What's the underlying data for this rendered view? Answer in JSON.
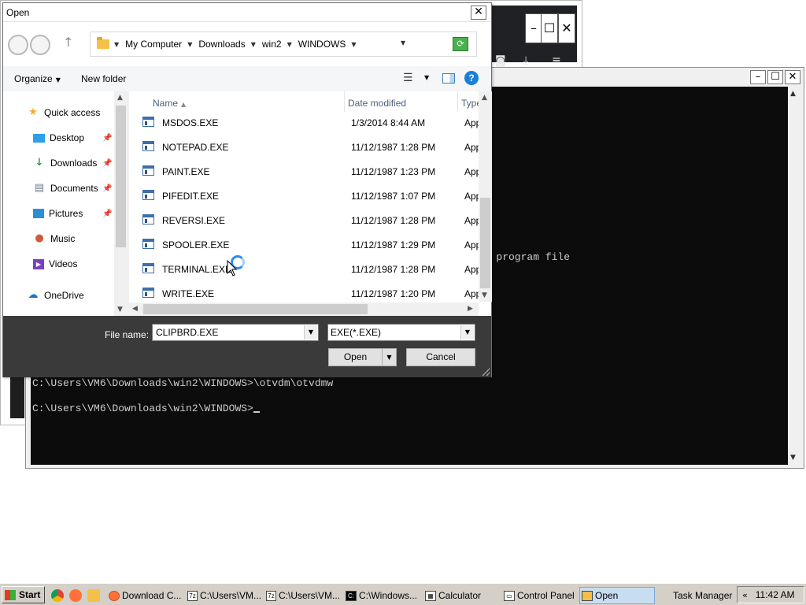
{
  "dialog": {
    "title": "Open",
    "close_label": "✕",
    "breadcrumbs": [
      "My Computer",
      "Downloads",
      "win2",
      "WINDOWS"
    ],
    "toolbar": {
      "organize": "Organize",
      "new_folder": "New folder"
    },
    "nav": {
      "quick_access": "Quick access",
      "items": [
        "Desktop",
        "Downloads",
        "Documents",
        "Pictures",
        "Music",
        "Videos"
      ],
      "onedrive": "OneDrive"
    },
    "columns": {
      "name": "Name",
      "date": "Date modified",
      "type": "Type"
    },
    "files": [
      {
        "name": "MSDOS.EXE",
        "date": "1/3/2014 8:44 AM",
        "type": "Application"
      },
      {
        "name": "NOTEPAD.EXE",
        "date": "11/12/1987 1:28 PM",
        "type": "Application"
      },
      {
        "name": "PAINT.EXE",
        "date": "11/12/1987 1:23 PM",
        "type": "Application"
      },
      {
        "name": "PIFEDIT.EXE",
        "date": "11/12/1987 1:07 PM",
        "type": "Application"
      },
      {
        "name": "REVERSI.EXE",
        "date": "11/12/1987 1:28 PM",
        "type": "Application"
      },
      {
        "name": "SPOOLER.EXE",
        "date": "11/12/1987 1:29 PM",
        "type": "Application"
      },
      {
        "name": "TERMINAL.EXE",
        "date": "11/12/1987 1:28 PM",
        "type": "Application"
      },
      {
        "name": "WRITE.EXE",
        "date": "11/12/1987 1:20 PM",
        "type": "Application"
      }
    ],
    "file_name_label": "File name:",
    "file_name_value": "CLIPBRD.EXE",
    "file_type_value": "EXE(*.EXE)",
    "open_button": "Open",
    "cancel_button": "Cancel"
  },
  "console": {
    "fragment": "id program file",
    "line1": "C:\\Users\\VM6\\Downloads\\win2\\WINDOWS>\\otvdm\\otvdmw",
    "line2": "C:\\Users\\VM6\\Downloads\\win2\\WINDOWS>"
  },
  "taskbar": {
    "start": "Start",
    "items": [
      {
        "label": "Download C...",
        "icon": "firefox-icon"
      },
      {
        "label": "C:\\Users\\VM...",
        "icon": "7zip-icon"
      },
      {
        "label": "C:\\Users\\VM...",
        "icon": "7zip-icon"
      },
      {
        "label": "C:\\Windows...",
        "icon": "cmd-icon"
      },
      {
        "label": "Calculator",
        "icon": "calculator-icon"
      },
      {
        "label": "Control Panel",
        "icon": "control-panel-icon"
      },
      {
        "label": "Open",
        "icon": "open-dialog-icon"
      },
      {
        "label": "Task Manager",
        "icon": "task-manager-icon"
      }
    ],
    "clock": "11:42 AM"
  },
  "colors": {
    "console_bg": "#0c0c0c",
    "console_fg": "#cccccc",
    "dialog_bottom": "#3a3a3a",
    "accent": "#1a7fd7",
    "taskbar": "#d4d0c8"
  }
}
